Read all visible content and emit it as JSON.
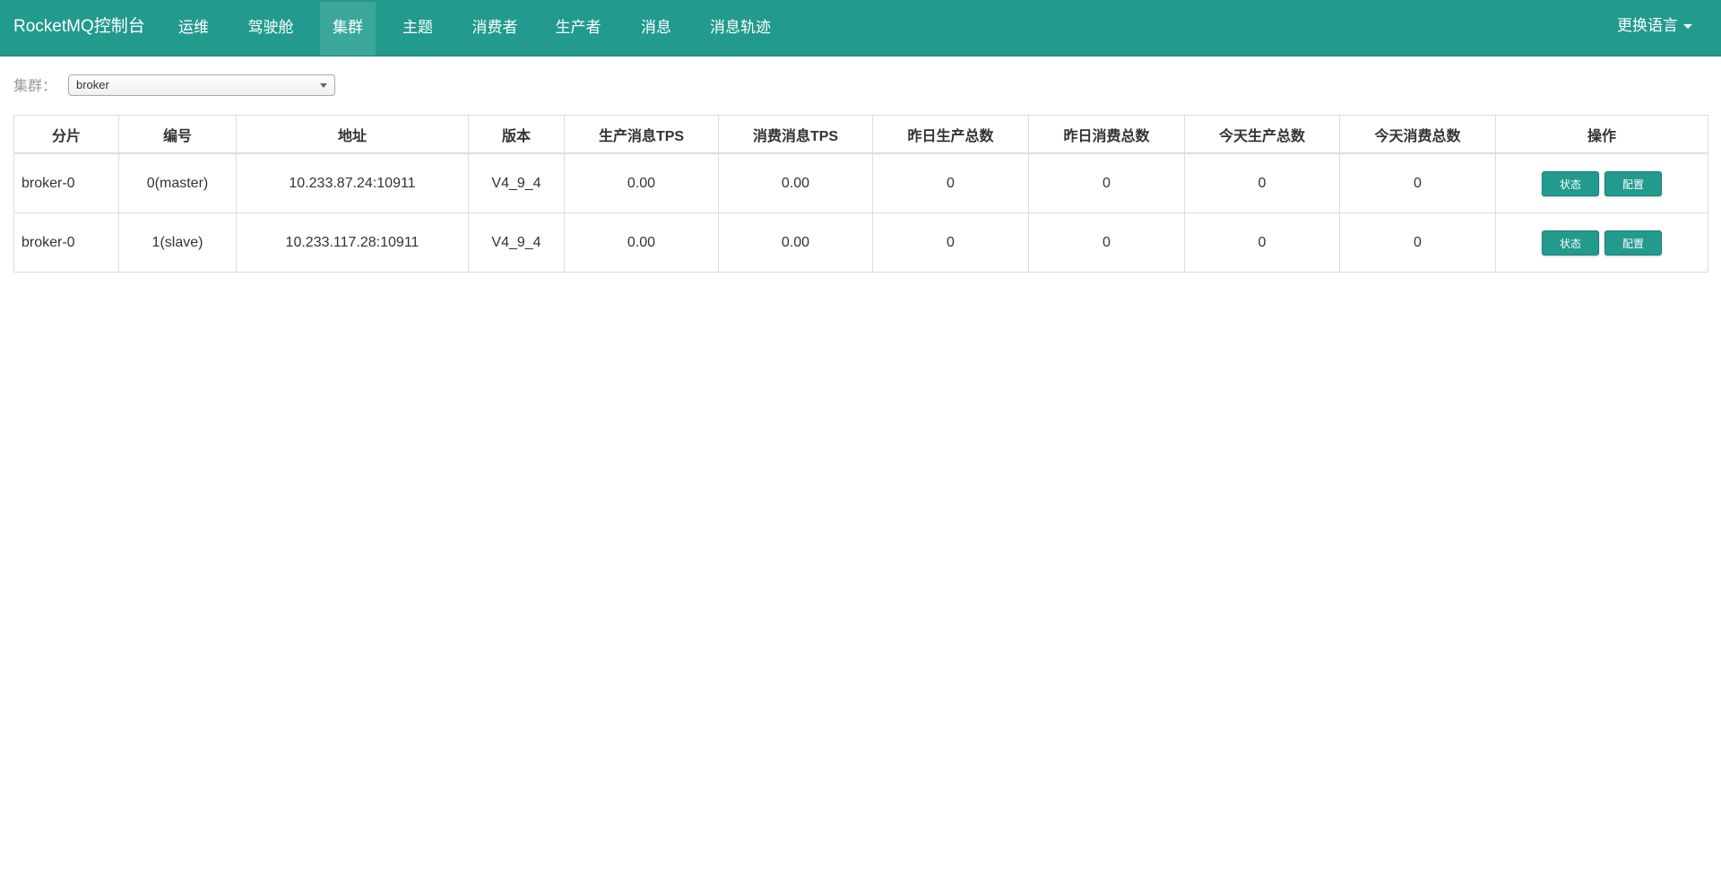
{
  "app": {
    "brand": "RocketMQ控制台",
    "nav": [
      {
        "label": "运维",
        "active": false
      },
      {
        "label": "驾驶舱",
        "active": false
      },
      {
        "label": "集群",
        "active": true
      },
      {
        "label": "主题",
        "active": false
      },
      {
        "label": "消费者",
        "active": false
      },
      {
        "label": "生产者",
        "active": false
      },
      {
        "label": "消息",
        "active": false
      },
      {
        "label": "消息轨迹",
        "active": false
      }
    ],
    "language_menu": "更换语言",
    "accent_color": "#229a8d"
  },
  "filter": {
    "label": "集群：",
    "selected": "broker"
  },
  "table": {
    "headers": [
      "分片",
      "编号",
      "地址",
      "版本",
      "生产消息TPS",
      "消费消息TPS",
      "昨日生产总数",
      "昨日消费总数",
      "今天生产总数",
      "今天消费总数",
      "操作"
    ],
    "rows": [
      {
        "shard": "broker-0",
        "id": "0(master)",
        "address": "10.233.87.24:10911",
        "version": "V4_9_4",
        "produce_tps": "0.00",
        "consume_tps": "0.00",
        "yesterday_produce": "0",
        "yesterday_consume": "0",
        "today_produce": "0",
        "today_consume": "0",
        "status_button": "状态",
        "config_button": "配置"
      },
      {
        "shard": "broker-0",
        "id": "1(slave)",
        "address": "10.233.117.28:10911",
        "version": "V4_9_4",
        "produce_tps": "0.00",
        "consume_tps": "0.00",
        "yesterday_produce": "0",
        "yesterday_consume": "0",
        "today_produce": "0",
        "today_consume": "0",
        "status_button": "状态",
        "config_button": "配置"
      }
    ]
  }
}
